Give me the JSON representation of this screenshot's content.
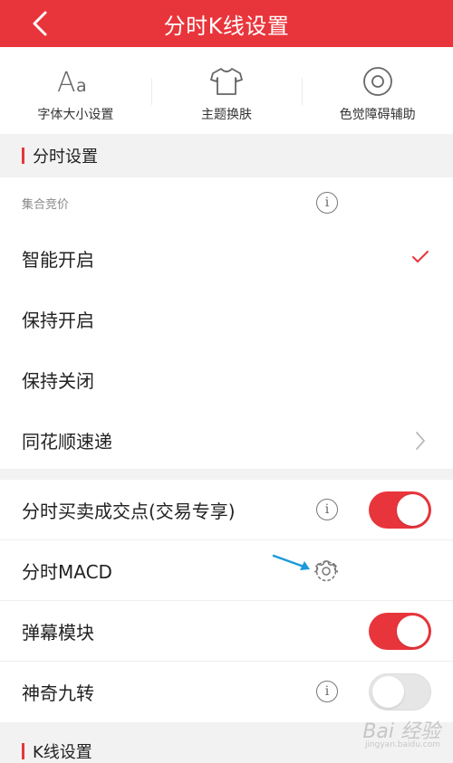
{
  "header": {
    "title": "分时K线设置"
  },
  "toolbar": [
    {
      "label": "字体大小设置",
      "icon": "font-size-icon"
    },
    {
      "label": "主题换肤",
      "icon": "tshirt-icon"
    },
    {
      "label": "色觉障碍辅助",
      "icon": "eye-target-icon"
    }
  ],
  "section1": {
    "title": "分时设置",
    "sub_label": "集合竞价",
    "options": [
      "智能开启",
      "保持开启",
      "保持关闭"
    ],
    "selected": "智能开启",
    "link_item": "同花顺速递"
  },
  "settings": [
    {
      "label": "分时买卖成交点(交易专享)",
      "toggle": true
    },
    {
      "label": "分时MACD"
    },
    {
      "label": "弹幕模块",
      "toggle": true
    },
    {
      "label": "神奇九转",
      "toggle": false
    }
  ],
  "section2": {
    "title": "K线设置"
  },
  "watermark": {
    "text": "Bai 经验",
    "sub": "jingyan.baidu.com"
  },
  "colors": {
    "accent": "#e8353b",
    "annotation_arrow": "#1a9ad9"
  }
}
